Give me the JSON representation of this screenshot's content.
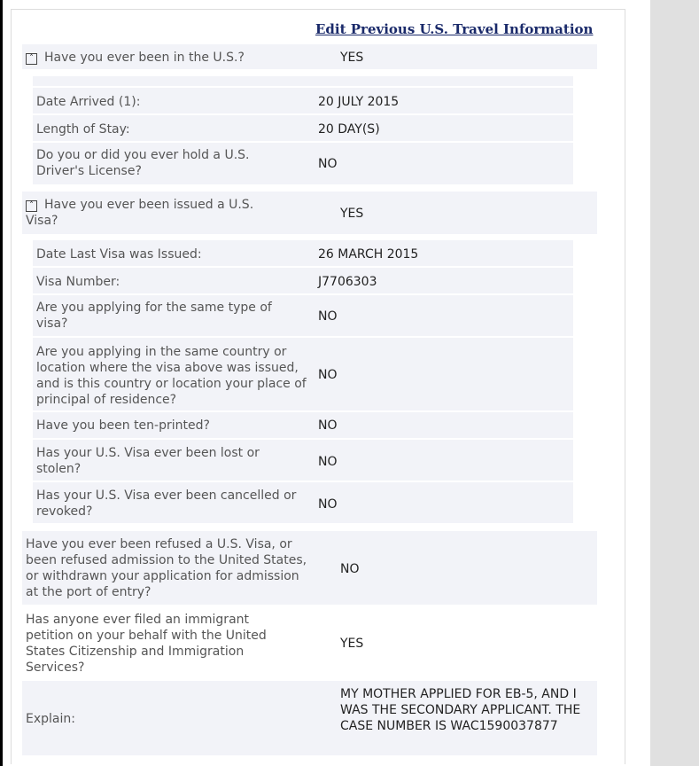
{
  "edit_link": "Edit Previous U.S. Travel Information",
  "rows": [
    {
      "q": "Have you ever been in the U.S.?",
      "a": "YES"
    },
    {
      "q": "",
      "a": ""
    },
    {
      "q": "Date Arrived (1):",
      "a": "20 JULY 2015"
    },
    {
      "q": "Length of Stay:",
      "a": "20 DAY(S)"
    },
    {
      "q": "Do you or did you ever hold a U.S. Driver's License?",
      "a": "NO"
    },
    {
      "q": "Have you ever been issued a U.S. Visa?",
      "a": "YES"
    },
    {
      "q": "Date Last Visa was Issued:",
      "a": "26 MARCH 2015"
    },
    {
      "q": "Visa Number:",
      "a": "J7706303"
    },
    {
      "q": "Are you applying for the same type of visa?",
      "a": "NO"
    },
    {
      "q": "Are you applying in the same country or location where the visa above was issued, and is this country or location your place of principal of residence?",
      "a": "NO"
    },
    {
      "q": "Have you been ten-printed?",
      "a": "NO"
    },
    {
      "q": "Has your U.S. Visa ever been lost or stolen?",
      "a": "NO"
    },
    {
      "q": "Has your U.S. Visa ever been cancelled or revoked?",
      "a": "NO"
    },
    {
      "q": "Have you ever been refused a U.S. Visa, or been refused admission to the United States, or withdrawn your application for admission at the port of entry?",
      "a": "NO"
    },
    {
      "q": "Has anyone ever filed an immigrant petition on your behalf with the United States Citizenship and Immigration Services?",
      "a": "YES"
    },
    {
      "q": "Explain:",
      "a": "MY MOTHER APPLIED FOR EB-5, AND I WAS THE SECONDARY APPLICANT. THE CASE NUMBER IS WAC1590037877"
    }
  ],
  "toggle_icon": "collapse-up-icon"
}
